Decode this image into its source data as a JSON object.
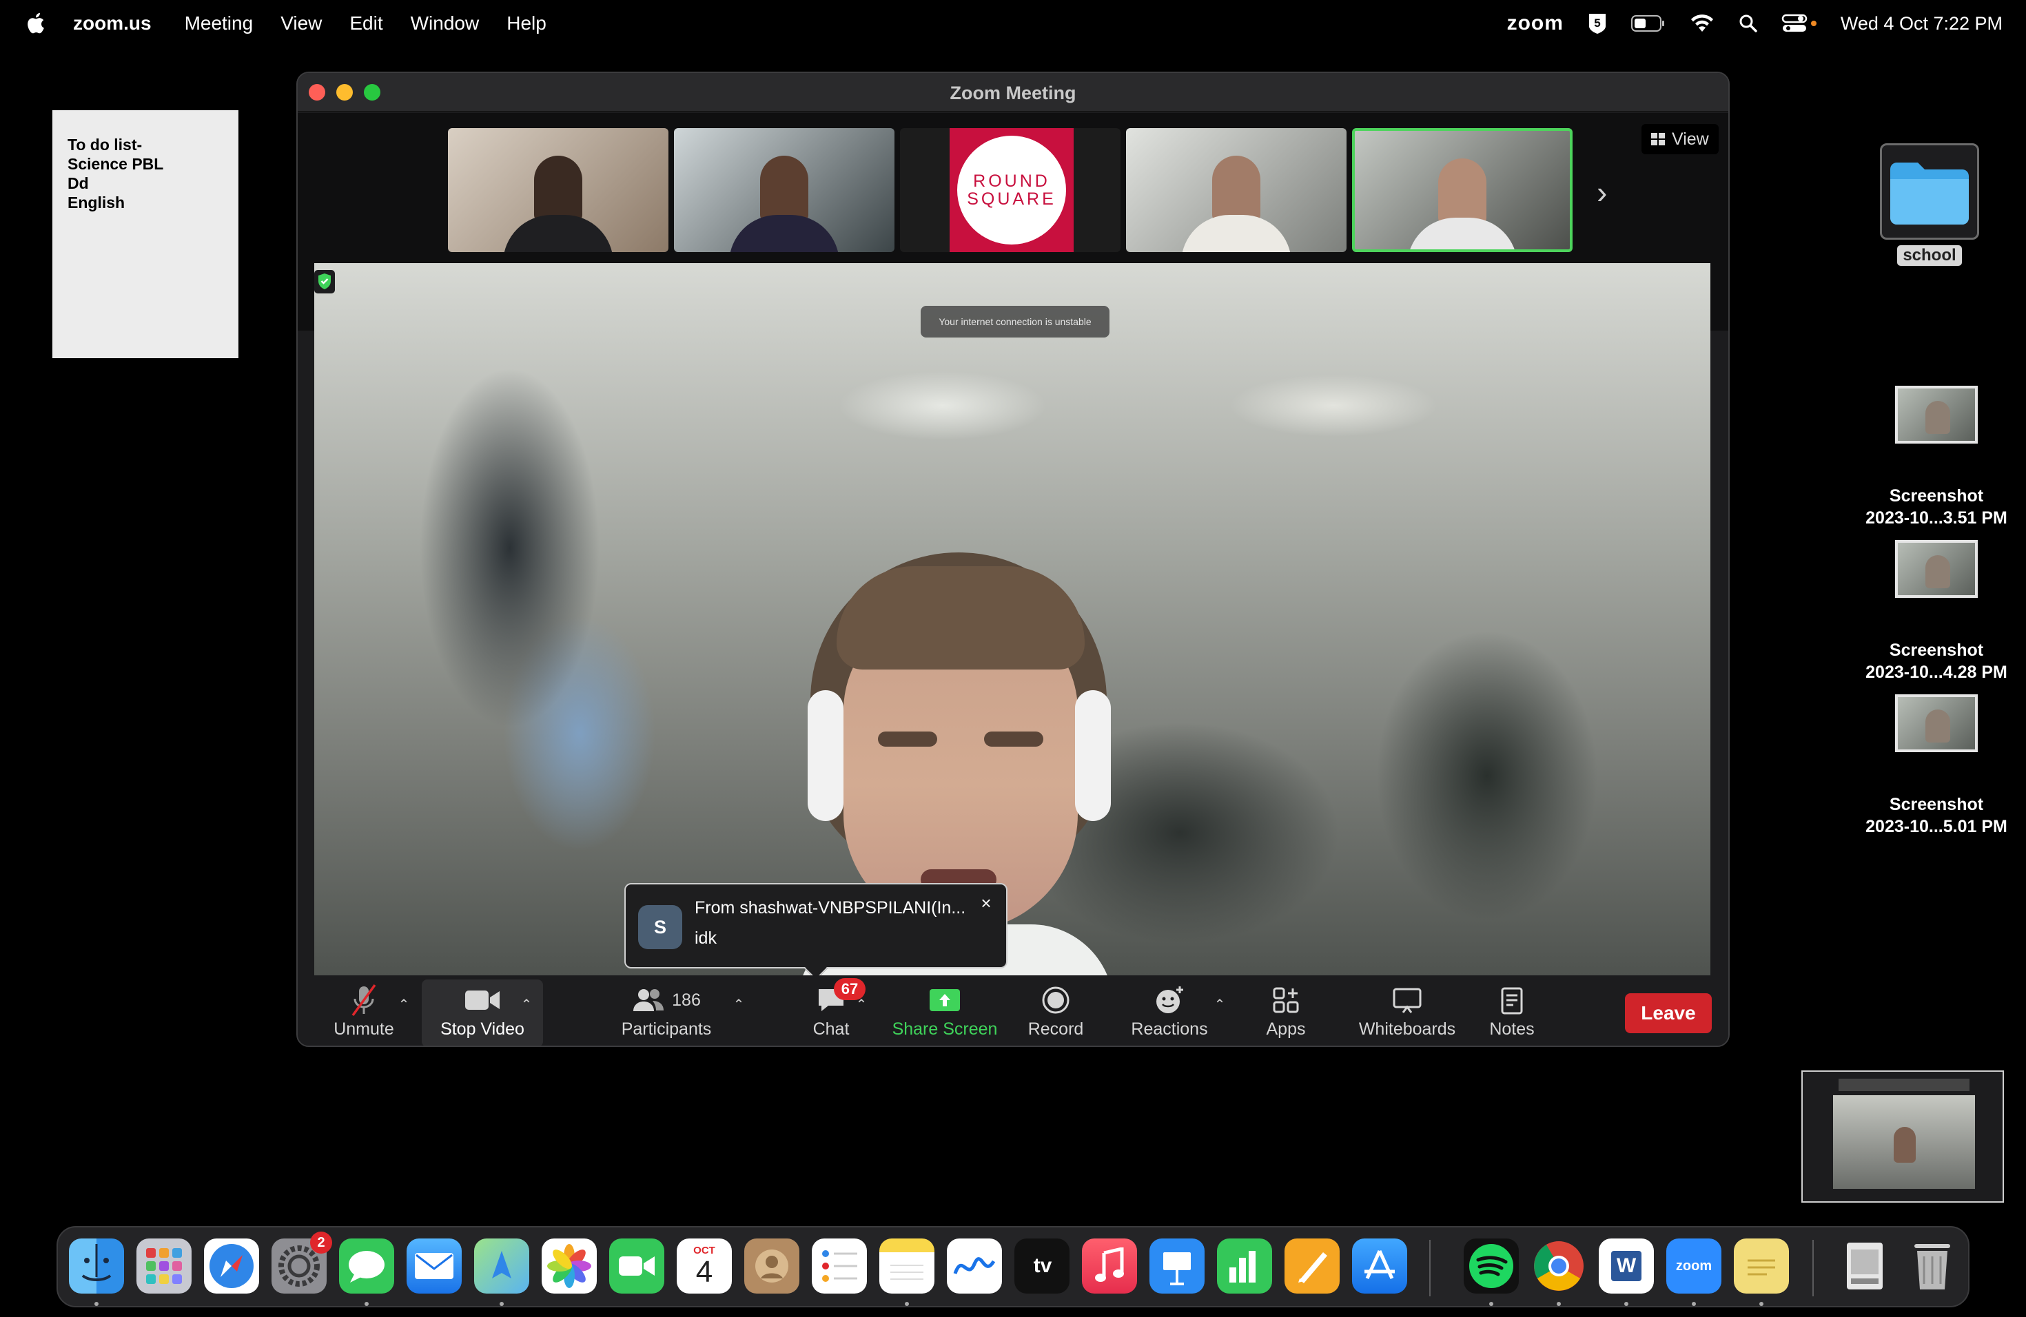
{
  "menubar": {
    "app_name": "zoom.us",
    "menus": [
      "Meeting",
      "View",
      "Edit",
      "Window",
      "Help"
    ],
    "zoom_status": "zoom",
    "datetime": "Wed 4 Oct  7:22 PM",
    "icons": [
      "apple-icon",
      "zoom-status-icon",
      "screen-time-icon",
      "battery-icon",
      "wifi-icon",
      "spotlight-icon",
      "control-center-icon"
    ]
  },
  "sticky_note": {
    "lines": [
      "To do list-",
      "Science PBL",
      "Dd",
      "English"
    ]
  },
  "desktop": {
    "folder_label": "school",
    "screenshots": [
      {
        "line1": "Screenshot",
        "line2": "2023-10...3.51 PM"
      },
      {
        "line1": "Screenshot",
        "line2": "2023-10...4.28 PM"
      },
      {
        "line1": "Screenshot",
        "line2": "2023-10...5.01 PM"
      }
    ]
  },
  "zoom_window": {
    "title": "Zoom Meeting",
    "view_label": "View",
    "round_square_lines": [
      "ROUND",
      "SQUARE"
    ],
    "connection_warning": "Your internet connection is unstable",
    "chat_popup": {
      "avatar_letter": "S",
      "from": "From shashwat-VNBPSPILANI(In...",
      "message": "idk"
    },
    "toolbar": {
      "unmute": "Unmute",
      "stop_video": "Stop Video",
      "participants": "Participants",
      "participants_count": "186",
      "chat": "Chat",
      "chat_badge": "67",
      "share_screen": "Share Screen",
      "record": "Record",
      "reactions": "Reactions",
      "apps": "Apps",
      "whiteboards": "Whiteboards",
      "notes": "Notes",
      "leave": "Leave"
    }
  },
  "dock": {
    "apps": [
      "Finder",
      "Launchpad",
      "Safari",
      "System Settings",
      "Messages",
      "Mail",
      "Maps",
      "Photos",
      "FaceTime",
      "Calendar",
      "Contacts",
      "Reminders",
      "Notes",
      "Freeform",
      "TV",
      "Music",
      "Keynote",
      "Numbers",
      "Pages",
      "App Store",
      "Spotify",
      "Chrome",
      "Word",
      "Zoom",
      "Stickies",
      "Preview",
      "Trash"
    ],
    "system_settings_badge": "2",
    "calendar_month": "OCT",
    "calendar_day": "4",
    "tv_label": "tv",
    "word_letter": "W",
    "zoom_label": "zoom"
  }
}
